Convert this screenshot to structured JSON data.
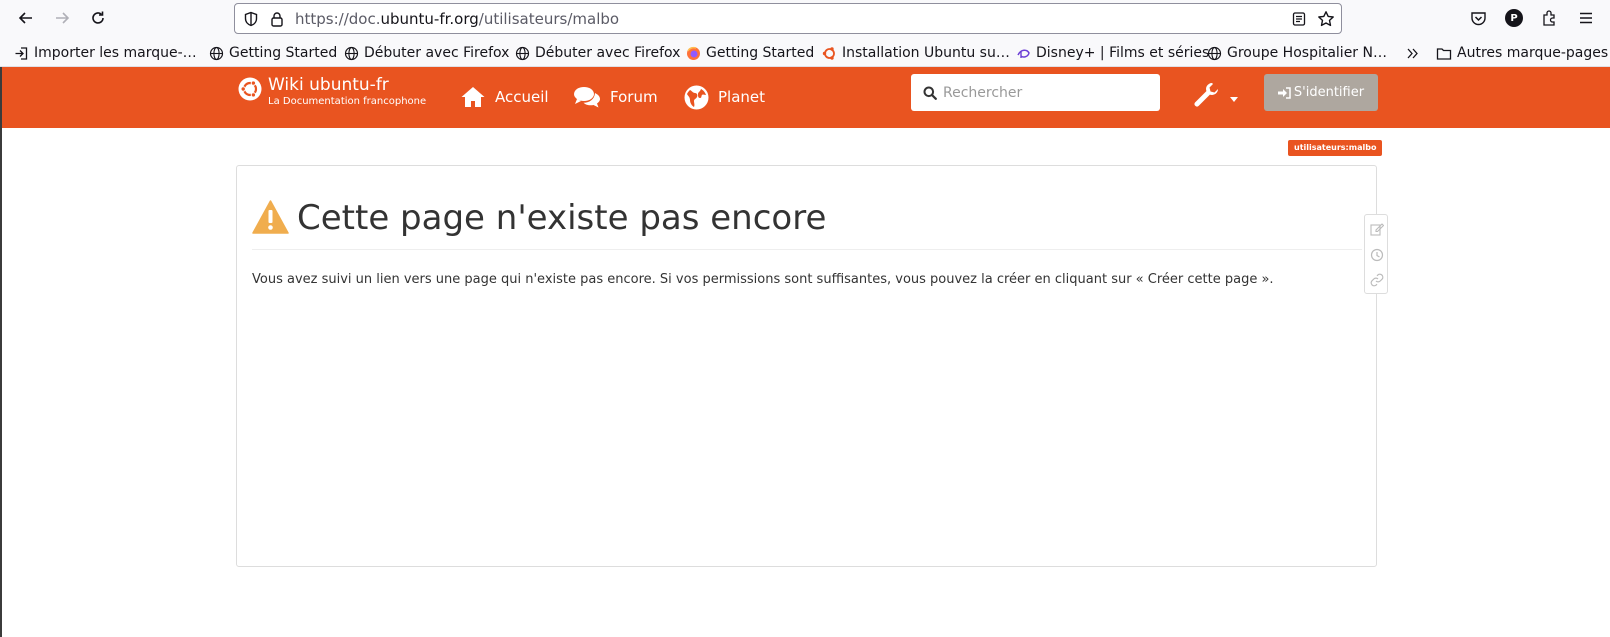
{
  "browser": {
    "url_prefix": "https://doc.",
    "url_domain": "ubuntu-fr.org",
    "url_path": "/utilisateurs/malbo",
    "profile_initial": "P"
  },
  "bookmarks": [
    {
      "label": "Importer les marque-…",
      "icon": "import-icon"
    },
    {
      "label": "Getting Started",
      "icon": "globe-icon"
    },
    {
      "label": "Débuter avec Firefox",
      "icon": "globe-icon"
    },
    {
      "label": "Débuter avec Firefox",
      "icon": "globe-icon"
    },
    {
      "label": "Getting Started",
      "icon": "firefox-icon"
    },
    {
      "label": "Installation Ubuntu su…",
      "icon": "ubuntu-icon"
    },
    {
      "label": "Disney+ | Films et séries",
      "icon": "disney-icon"
    },
    {
      "label": "Groupe Hospitalier N…",
      "icon": "globe-icon"
    }
  ],
  "other_bookmarks": "Autres marque-pages",
  "site": {
    "brand_title": "Wiki ubuntu-fr",
    "brand_subtitle": "La Documentation francophone",
    "nav": [
      "Accueil",
      "Forum",
      "Planet"
    ],
    "search_placeholder": "Rechercher",
    "login_label": "S'identifier",
    "accent": "#e95420"
  },
  "content": {
    "pagename_badge": "utilisateurs:malbo",
    "heading": "Cette page n'existe pas encore",
    "text": "Vous avez suivi un lien vers une page qui n'existe pas encore. Si vos permissions sont suffisantes, vous pouvez la créer en cliquant sur « Créer cette page »."
  }
}
